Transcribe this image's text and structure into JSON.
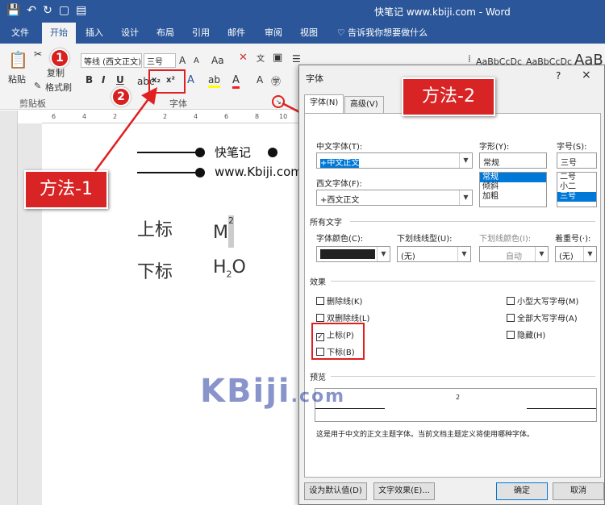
{
  "titlebar": {
    "window_title": "快笔记 www.kbiji.com - Word"
  },
  "ribbon_tabs": [
    "文件",
    "开始",
    "插入",
    "设计",
    "布局",
    "引用",
    "邮件",
    "审阅",
    "视图"
  ],
  "tell_me": "告诉我你想要做什么",
  "ribbon": {
    "paste": "粘贴",
    "copy": "复制",
    "format_painter": "格式刷",
    "clipboard_group": "剪贴板",
    "font_name": "等线 (西文正文)",
    "font_size": "三号",
    "font_group": "字体",
    "grow": "A",
    "shrink": "A",
    "case": "Aa",
    "bold": "B",
    "italic": "I",
    "underline": "U",
    "subscript": "x₂",
    "superscript": "x²",
    "styles": [
      "AaBbCcDc",
      "AaBbCcDc",
      "AaB"
    ]
  },
  "badges": {
    "one": "1",
    "two": "2"
  },
  "ruler": {
    "marks": [
      "6",
      "4",
      "2",
      "2",
      "4",
      "6",
      "8",
      "10"
    ]
  },
  "document": {
    "brand": "快笔记",
    "site": "www.Kbiji.com",
    "sup_label": "上标",
    "sup_example_base": "M",
    "sup_example_exp": "2",
    "sub_label": "下标",
    "sub_example_base": "H",
    "sub_example_sub": "2",
    "sub_example_tail": "O"
  },
  "callouts": {
    "method1": "方法-1",
    "method2": "方法-2"
  },
  "dialog": {
    "title": "字体",
    "help": "?",
    "close": "×",
    "tabs": [
      "字体(N)",
      "高级(V)"
    ],
    "cn_font_label": "中文字体(T):",
    "cn_font_value": "+中文正文",
    "west_font_label": "西文字体(F):",
    "west_font_value": "+西文正文",
    "style_label": "字形(Y):",
    "style_value": "常规",
    "style_options": [
      "常规",
      "倾斜",
      "加粗"
    ],
    "size_label": "字号(S):",
    "size_value": "三号",
    "size_options": [
      "二号",
      "小二",
      "三号"
    ],
    "all_text_section": "所有文字",
    "color_label": "字体颜色(C):",
    "underline_label": "下划线线型(U):",
    "underline_value": "(无)",
    "underline_color_label": "下划线颜色(I):",
    "underline_color_value": "自动",
    "emphasis_label": "着重号(·):",
    "emphasis_value": "(无)",
    "effects_section": "效果",
    "effects_left": [
      {
        "label": "删除线(K)",
        "checked": false
      },
      {
        "label": "双删除线(L)",
        "checked": false
      },
      {
        "label": "上标(P)",
        "checked": true
      },
      {
        "label": "下标(B)",
        "checked": false
      }
    ],
    "effects_right": [
      {
        "label": "小型大写字母(M)",
        "checked": false
      },
      {
        "label": "全部大写字母(A)",
        "checked": false
      },
      {
        "label": "隐藏(H)",
        "checked": false
      }
    ],
    "preview_section": "预览",
    "preview_text": "2",
    "note": "这是用于中文的正文主题字体。当前文档主题定义将使用哪种字体。",
    "btn_default": "设为默认值(D)",
    "btn_effects": "文字效果(E)...",
    "btn_ok": "确定",
    "btn_cancel": "取消",
    "check_mark": "✓"
  },
  "watermark": {
    "main": "KBiji",
    "suffix": ".com"
  },
  "colors": {
    "accent": "#2b579a",
    "red": "#d82424",
    "select": "#0078d7"
  }
}
